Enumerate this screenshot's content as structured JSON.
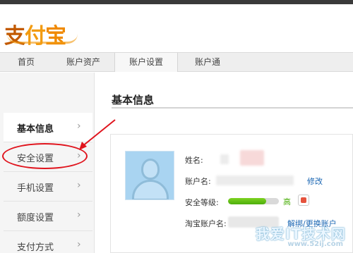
{
  "header": {
    "logo_text_1": "支",
    "logo_text_2": "付",
    "logo_text_3": "宝"
  },
  "nav": {
    "items": [
      {
        "label": "首页"
      },
      {
        "label": "账户资产"
      },
      {
        "label": "账户设置"
      },
      {
        "label": "账户通"
      }
    ],
    "active_index": 2
  },
  "sidebar": {
    "items": [
      {
        "label": "基本信息",
        "chevron": "›"
      },
      {
        "label": "安全设置",
        "chevron": "›"
      },
      {
        "label": "手机设置",
        "chevron": "›"
      },
      {
        "label": "额度设置",
        "chevron": "›"
      },
      {
        "label": "支付方式",
        "chevron": "›"
      }
    ],
    "active_index": 0
  },
  "main": {
    "title": "基本信息",
    "name_label": "姓名:",
    "account_label": "账户名:",
    "modify_link": "修改",
    "security_label": "安全等级:",
    "security_level": 0.75,
    "security_level_text": "高",
    "taobao_label": "淘宝账户名:",
    "unbind_link": "解绑/更换账户"
  },
  "watermark": {
    "main": "我爱IT技术网",
    "sub": "www.52ij.com"
  },
  "colors": {
    "brand_orange": "#f08a00",
    "link_blue": "#1a66b3",
    "level_green": "#4cae0c",
    "annotation_red": "#e0141d"
  }
}
